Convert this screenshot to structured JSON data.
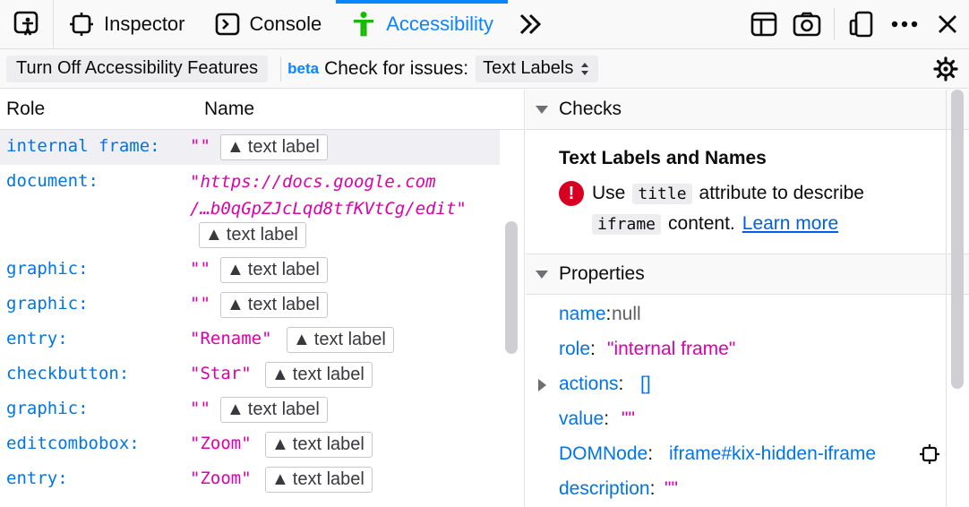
{
  "tabs": [
    {
      "label": "Inspector",
      "icon": "inspector-icon"
    },
    {
      "label": "Console",
      "icon": "console-icon"
    },
    {
      "label": "Accessibility",
      "icon": "accessibility-icon",
      "selected": true
    }
  ],
  "toolbar": {
    "turn_off_label": "Turn Off Accessibility Features",
    "beta_label": "beta",
    "check_label": "Check for issues:",
    "check_value": "Text Labels"
  },
  "tree": {
    "col_role": "Role",
    "col_name": "Name",
    "badge_label": "text label",
    "rows": [
      {
        "role": "internal frame:",
        "name": "\"\""
      },
      {
        "role": "document:",
        "name_line1": "\"https://docs.google.com",
        "name_line2": "/…b0qGpZJcLqd8tfKVtCg/edit\""
      },
      {
        "role": "graphic:",
        "name": "\"\""
      },
      {
        "role": "graphic:",
        "name": "\"\""
      },
      {
        "role": "entry:",
        "name": "\"Rename\""
      },
      {
        "role": "checkbutton:",
        "name": "\"Star\""
      },
      {
        "role": "graphic:",
        "name": "\"\""
      },
      {
        "role": "editcombobox:",
        "name": "\"Zoom\""
      },
      {
        "role": "entry:",
        "name": "\"Zoom\""
      }
    ]
  },
  "checks": {
    "header": "Checks",
    "title": "Text Labels and Names",
    "text_use": "Use",
    "code_title": "title",
    "text_attr": "attribute to describe",
    "code_iframe": "iframe",
    "text_content": "content.",
    "learn_more": "Learn more"
  },
  "properties": {
    "header": "Properties",
    "items": [
      {
        "key": "name",
        "value": "null"
      },
      {
        "key": "role",
        "value": "\"internal frame\""
      },
      {
        "key": "actions",
        "value": "[]"
      },
      {
        "key": "value",
        "value": "\"\""
      },
      {
        "key": "DOMNode",
        "value": "iframe#kix-hidden-iframe"
      },
      {
        "key": "description",
        "value": "\"\""
      }
    ]
  },
  "colors": {
    "accent": "#0a84ff",
    "role": "#0074e8",
    "string": "#dd00a9",
    "error": "#d70022"
  }
}
